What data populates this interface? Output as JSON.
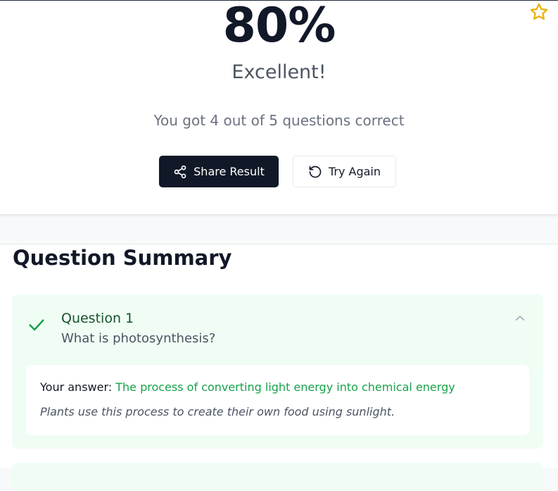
{
  "result": {
    "score": "80%",
    "verdict": "Excellent!",
    "subtitle": "You got 4 out of 5 questions correct",
    "share_label": "Share Result",
    "retry_label": "Try Again"
  },
  "summary": {
    "title": "Question Summary",
    "questions": [
      {
        "number_label": "Question 1",
        "text": "What is photosynthesis?",
        "status": "correct",
        "answer_label": "Your answer:",
        "answer": "The process of converting light energy into chemical energy",
        "explanation": "Plants use this process to create their own food using sunlight."
      }
    ]
  },
  "icons": {
    "favorite": "star-icon",
    "share": "share-icon",
    "retry": "rotate-ccw-icon",
    "correct": "check-icon",
    "collapse": "chevron-up-icon"
  },
  "colors": {
    "primary": "#111827",
    "correct_bg": "#f0fdf4",
    "correct_text": "#16a34a",
    "star": "#eab308"
  }
}
